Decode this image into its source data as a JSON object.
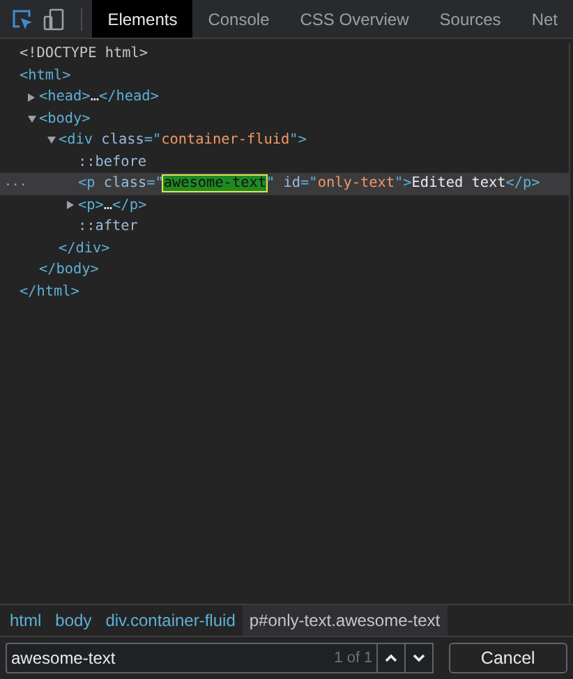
{
  "toolbar": {
    "inspect_active": true,
    "tabs": [
      {
        "label": "Elements",
        "selected": true
      },
      {
        "label": "Console",
        "selected": false
      },
      {
        "label": "CSS Overview",
        "selected": false
      },
      {
        "label": "Sources",
        "selected": false
      },
      {
        "label": "Net",
        "selected": false
      }
    ]
  },
  "dom_tree": [
    {
      "tokens": [
        {
          "kind": "doctype",
          "text": "<!DOCTYPE html>"
        }
      ],
      "selected": false
    },
    {
      "tokens": [
        {
          "kind": "tag",
          "text": "<html>"
        }
      ],
      "selected": false,
      "closing": "</html>",
      "children": [
        {
          "tokens": [
            {
              "kind": "tag",
              "text": "<head>"
            },
            {
              "kind": "text",
              "text": "…"
            },
            {
              "kind": "tag",
              "text": "</head>"
            }
          ],
          "expanded": false,
          "selected": false
        },
        {
          "tokens": [
            {
              "kind": "tag",
              "text": "<body>"
            }
          ],
          "expanded": true,
          "selected": false,
          "closing": "</body>",
          "children": [
            {
              "tokens": [
                {
                  "kind": "tag",
                  "text": "<div"
                },
                {
                  "kind": "attr",
                  "text": " class"
                },
                {
                  "kind": "tag",
                  "text": "=\""
                },
                {
                  "kind": "value",
                  "text": "container-fluid"
                },
                {
                  "kind": "tag",
                  "text": "\">"
                }
              ],
              "expanded": true,
              "selected": false,
              "closing": "</div>",
              "children": [
                {
                  "tokens": [
                    {
                      "kind": "pseudo",
                      "text": "::before"
                    }
                  ],
                  "selected": false
                },
                {
                  "tokens": [
                    {
                      "kind": "tag",
                      "text": "<p"
                    },
                    {
                      "kind": "attr",
                      "text": " class"
                    },
                    {
                      "kind": "tag",
                      "text": "=\""
                    },
                    {
                      "kind": "match",
                      "text": "awesome-text"
                    },
                    {
                      "kind": "tag",
                      "text": "\""
                    },
                    {
                      "kind": "attr",
                      "text": " id"
                    },
                    {
                      "kind": "tag",
                      "text": "=\""
                    },
                    {
                      "kind": "value",
                      "text": "only-text"
                    },
                    {
                      "kind": "tag",
                      "text": "\">"
                    },
                    {
                      "kind": "text",
                      "text": "Edited text"
                    },
                    {
                      "kind": "tag",
                      "text": "</p>"
                    }
                  ],
                  "selected": true,
                  "menu": "..."
                },
                {
                  "tokens": [
                    {
                      "kind": "tag",
                      "text": "<p>"
                    },
                    {
                      "kind": "text",
                      "text": "…"
                    },
                    {
                      "kind": "tag",
                      "text": "</p>"
                    }
                  ],
                  "expanded": false,
                  "selected": false
                },
                {
                  "tokens": [
                    {
                      "kind": "pseudo",
                      "text": "::after"
                    }
                  ],
                  "selected": false
                }
              ]
            }
          ]
        }
      ]
    }
  ],
  "breadcrumbs": [
    {
      "label": "html",
      "selected": false
    },
    {
      "label": "body",
      "selected": false
    },
    {
      "label": "div.container-fluid",
      "selected": false
    },
    {
      "label": "p#only-text.awesome-text",
      "selected": true
    }
  ],
  "search": {
    "value": "awesome-text",
    "count": "1 of 1",
    "cancel": "Cancel"
  }
}
